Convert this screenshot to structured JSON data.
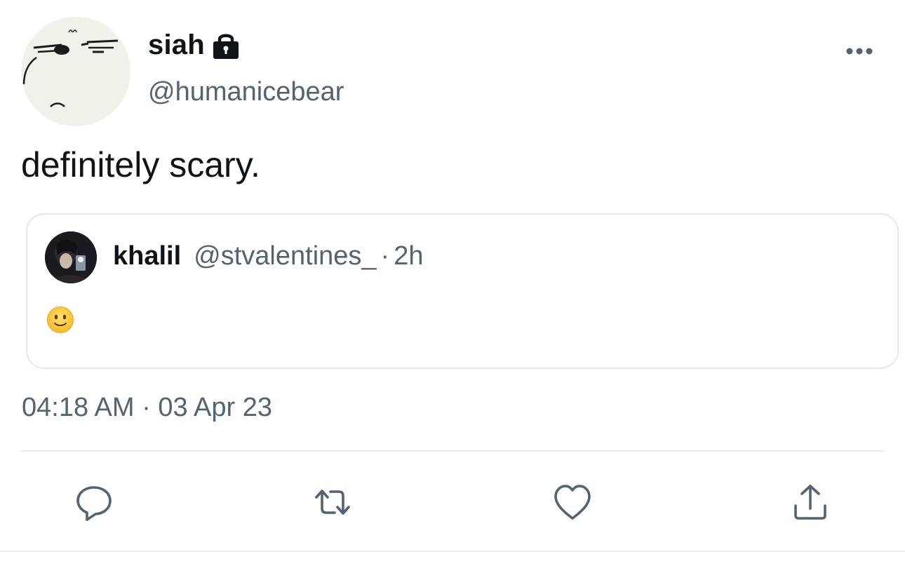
{
  "tweet": {
    "author": {
      "display_name": "siah",
      "handle": "@humanicebear",
      "protected_icon": "lock-icon",
      "avatar_icon": "ice-bear-face-avatar"
    },
    "text": "definitely scary.",
    "timestamp": "04:18 AM · 03 Apr 23",
    "more_icon": "more-horizontal-icon"
  },
  "quoted_tweet": {
    "display_name": "khalil",
    "handle": "@stvalentines_",
    "separator": "·",
    "relative_time": "2h",
    "body_icon": "slightly-smiling-face-emoji"
  },
  "actions": {
    "reply_icon": "reply-icon",
    "retweet_icon": "retweet-icon",
    "like_icon": "heart-icon",
    "share_icon": "share-icon"
  },
  "colors": {
    "text_primary": "#0f1419",
    "text_secondary": "#536471",
    "border": "#e3e8ec",
    "icon": "#536471"
  }
}
